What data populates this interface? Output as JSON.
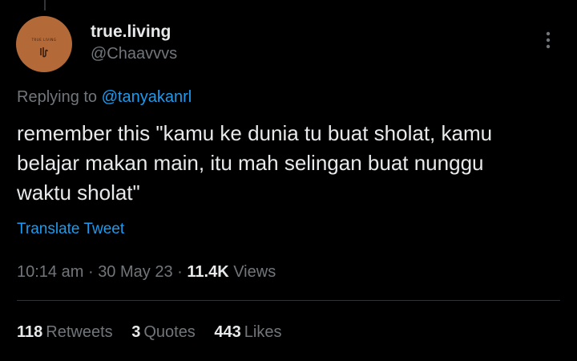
{
  "tweet": {
    "author_name": "true.living",
    "author_handle": "@Chaavvvs",
    "avatar_color": "#b46a38",
    "avatar_logo_text": "TRUE LIVING",
    "replying_prefix": "Replying to",
    "replying_to": "@tanyakanrl",
    "text": "remember this \"kamu ke dunia tu buat sholat, kamu\nbelajar makan main, itu mah selingan buat nunggu\nwaktu sholat\"",
    "translate_label": "Translate Tweet",
    "time": "10:14 am",
    "date": "30 May 23",
    "separator": "·",
    "views_count": "11.4K",
    "views_label": "Views"
  },
  "stats": {
    "retweets_count": "118",
    "retweets_label": "Retweets",
    "quotes_count": "3",
    "quotes_label": "Quotes",
    "likes_count": "443",
    "likes_label": "Likes"
  },
  "colors": {
    "background": "#000000",
    "primary_text": "#e7e9ea",
    "secondary_text": "#71767b",
    "link": "#1d9bf0",
    "divider": "#2f3336"
  },
  "icons": {
    "more": "more-vertical-icon"
  }
}
